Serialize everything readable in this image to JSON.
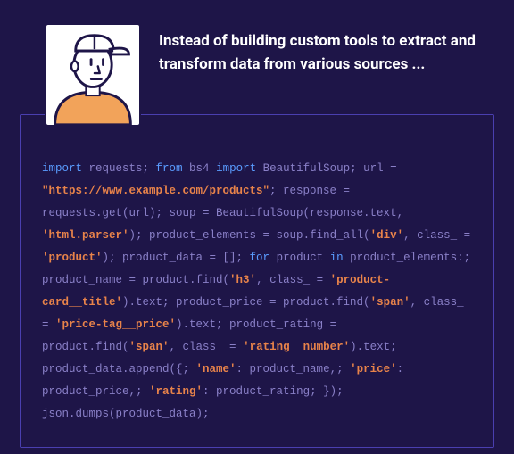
{
  "header": {
    "headline": "Instead of building custom tools to extract and transform data from various sources ..."
  },
  "code": {
    "tokens": [
      {
        "t": "kw",
        "v": "import"
      },
      {
        "t": "pl",
        "v": " requests; "
      },
      {
        "t": "kw",
        "v": "from"
      },
      {
        "t": "pl",
        "v": " bs4 "
      },
      {
        "t": "kw",
        "v": "import"
      },
      {
        "t": "pl",
        "v": " BeautifulSoup; url = "
      },
      {
        "t": "str",
        "v": "\"https://www.example.com/products\""
      },
      {
        "t": "pl",
        "v": "; response = requests.get(url); soup = BeautifulSoup(response.text, "
      },
      {
        "t": "str",
        "v": "'html.parser'"
      },
      {
        "t": "pl",
        "v": "); product_elements = soup.find_all("
      },
      {
        "t": "str",
        "v": "'div'"
      },
      {
        "t": "pl",
        "v": ", class_ = "
      },
      {
        "t": "str",
        "v": "'product'"
      },
      {
        "t": "pl",
        "v": "); product_data = []; "
      },
      {
        "t": "kw",
        "v": "for"
      },
      {
        "t": "pl",
        "v": " product "
      },
      {
        "t": "kw",
        "v": "in"
      },
      {
        "t": "pl",
        "v": " product_elements:; product_name = product.find("
      },
      {
        "t": "str",
        "v": "'h3'"
      },
      {
        "t": "pl",
        "v": ", class_ = "
      },
      {
        "t": "str",
        "v": "'product-card__title'"
      },
      {
        "t": "pl",
        "v": ").text; product_price = product.find("
      },
      {
        "t": "str",
        "v": "'span'"
      },
      {
        "t": "pl",
        "v": ", class_ = "
      },
      {
        "t": "str",
        "v": "'price-tag__price'"
      },
      {
        "t": "pl",
        "v": ").text; product_rating = product.find("
      },
      {
        "t": "str",
        "v": "'span'"
      },
      {
        "t": "pl",
        "v": ", class_ = "
      },
      {
        "t": "str",
        "v": "'rating__number'"
      },
      {
        "t": "pl",
        "v": ").text; product_data.append({; "
      },
      {
        "t": "str",
        "v": "'name'"
      },
      {
        "t": "pl",
        "v": ": product_name,; "
      },
      {
        "t": "str",
        "v": "'price'"
      },
      {
        "t": "pl",
        "v": ": product_price,; "
      },
      {
        "t": "str",
        "v": "'rating'"
      },
      {
        "t": "pl",
        "v": ": product_rating; }); json.dumps(product_data);"
      }
    ]
  }
}
